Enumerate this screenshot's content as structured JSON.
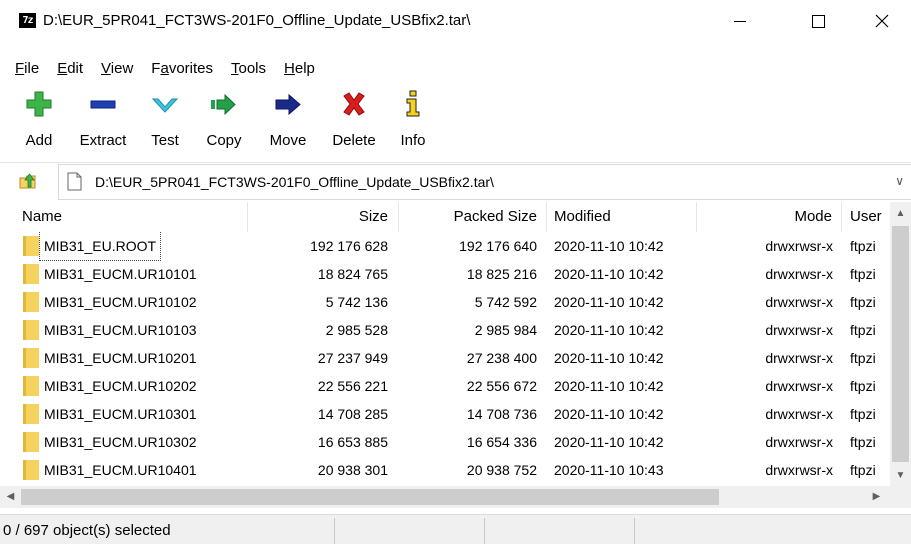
{
  "window": {
    "app_icon_text": "7z",
    "title": "D:\\EUR_5PR041_FCT3WS-201F0_Offline_Update_USBfix2.tar\\"
  },
  "menu": [
    {
      "label": "File",
      "accel": "F",
      "rest": "ile"
    },
    {
      "label": "Edit",
      "accel": "E",
      "rest": "dit"
    },
    {
      "label": "View",
      "accel": "V",
      "rest": "iew"
    },
    {
      "label": "Favorites",
      "accel": "a",
      "pre": "F",
      "rest": "vorites"
    },
    {
      "label": "Tools",
      "accel": "T",
      "rest": "ools"
    },
    {
      "label": "Help",
      "accel": "H",
      "rest": "elp"
    }
  ],
  "toolbar": {
    "add": "Add",
    "extract": "Extract",
    "test": "Test",
    "copy": "Copy",
    "move": "Move",
    "delete": "Delete",
    "info": "Info"
  },
  "address": {
    "path": "D:\\EUR_5PR041_FCT3WS-201F0_Offline_Update_USBfix2.tar\\"
  },
  "columns": {
    "name": "Name",
    "size": "Size",
    "packed": "Packed Size",
    "modified": "Modified",
    "mode": "Mode",
    "user": "User"
  },
  "files": [
    {
      "name": "MIB31_EU.ROOT",
      "size": "192 176 628",
      "packed": "192 176 640",
      "modified": "2020-11-10 10:42",
      "mode": "drwxrwsr-x",
      "user": "ftpzi"
    },
    {
      "name": "MIB31_EUCM.UR10101",
      "size": "18 824 765",
      "packed": "18 825 216",
      "modified": "2020-11-10 10:42",
      "mode": "drwxrwsr-x",
      "user": "ftpzi"
    },
    {
      "name": "MIB31_EUCM.UR10102",
      "size": "5 742 136",
      "packed": "5 742 592",
      "modified": "2020-11-10 10:42",
      "mode": "drwxrwsr-x",
      "user": "ftpzi"
    },
    {
      "name": "MIB31_EUCM.UR10103",
      "size": "2 985 528",
      "packed": "2 985 984",
      "modified": "2020-11-10 10:42",
      "mode": "drwxrwsr-x",
      "user": "ftpzi"
    },
    {
      "name": "MIB31_EUCM.UR10201",
      "size": "27 237 949",
      "packed": "27 238 400",
      "modified": "2020-11-10 10:42",
      "mode": "drwxrwsr-x",
      "user": "ftpzi"
    },
    {
      "name": "MIB31_EUCM.UR10202",
      "size": "22 556 221",
      "packed": "22 556 672",
      "modified": "2020-11-10 10:42",
      "mode": "drwxrwsr-x",
      "user": "ftpzi"
    },
    {
      "name": "MIB31_EUCM.UR10301",
      "size": "14 708 285",
      "packed": "14 708 736",
      "modified": "2020-11-10 10:42",
      "mode": "drwxrwsr-x",
      "user": "ftpzi"
    },
    {
      "name": "MIB31_EUCM.UR10302",
      "size": "16 653 885",
      "packed": "16 654 336",
      "modified": "2020-11-10 10:42",
      "mode": "drwxrwsr-x",
      "user": "ftpzi"
    },
    {
      "name": "MIB31_EUCM.UR10401",
      "size": "20 938 301",
      "packed": "20 938 752",
      "modified": "2020-11-10 10:43",
      "mode": "drwxrwsr-x",
      "user": "ftpzi"
    }
  ],
  "status": {
    "selection": "0 / 697 object(s) selected"
  },
  "colors": {
    "folder": "#f6d25f",
    "folder_dark": "#e1b53b",
    "add_green": "#3cb44a",
    "extract_blue": "#1f3fb5",
    "test_cyan": "#3ec6e0",
    "copy_green": "#22a04a",
    "move_navy": "#1a2a8a",
    "delete_red": "#d81e1e",
    "info_yellow": "#f2d21a"
  }
}
